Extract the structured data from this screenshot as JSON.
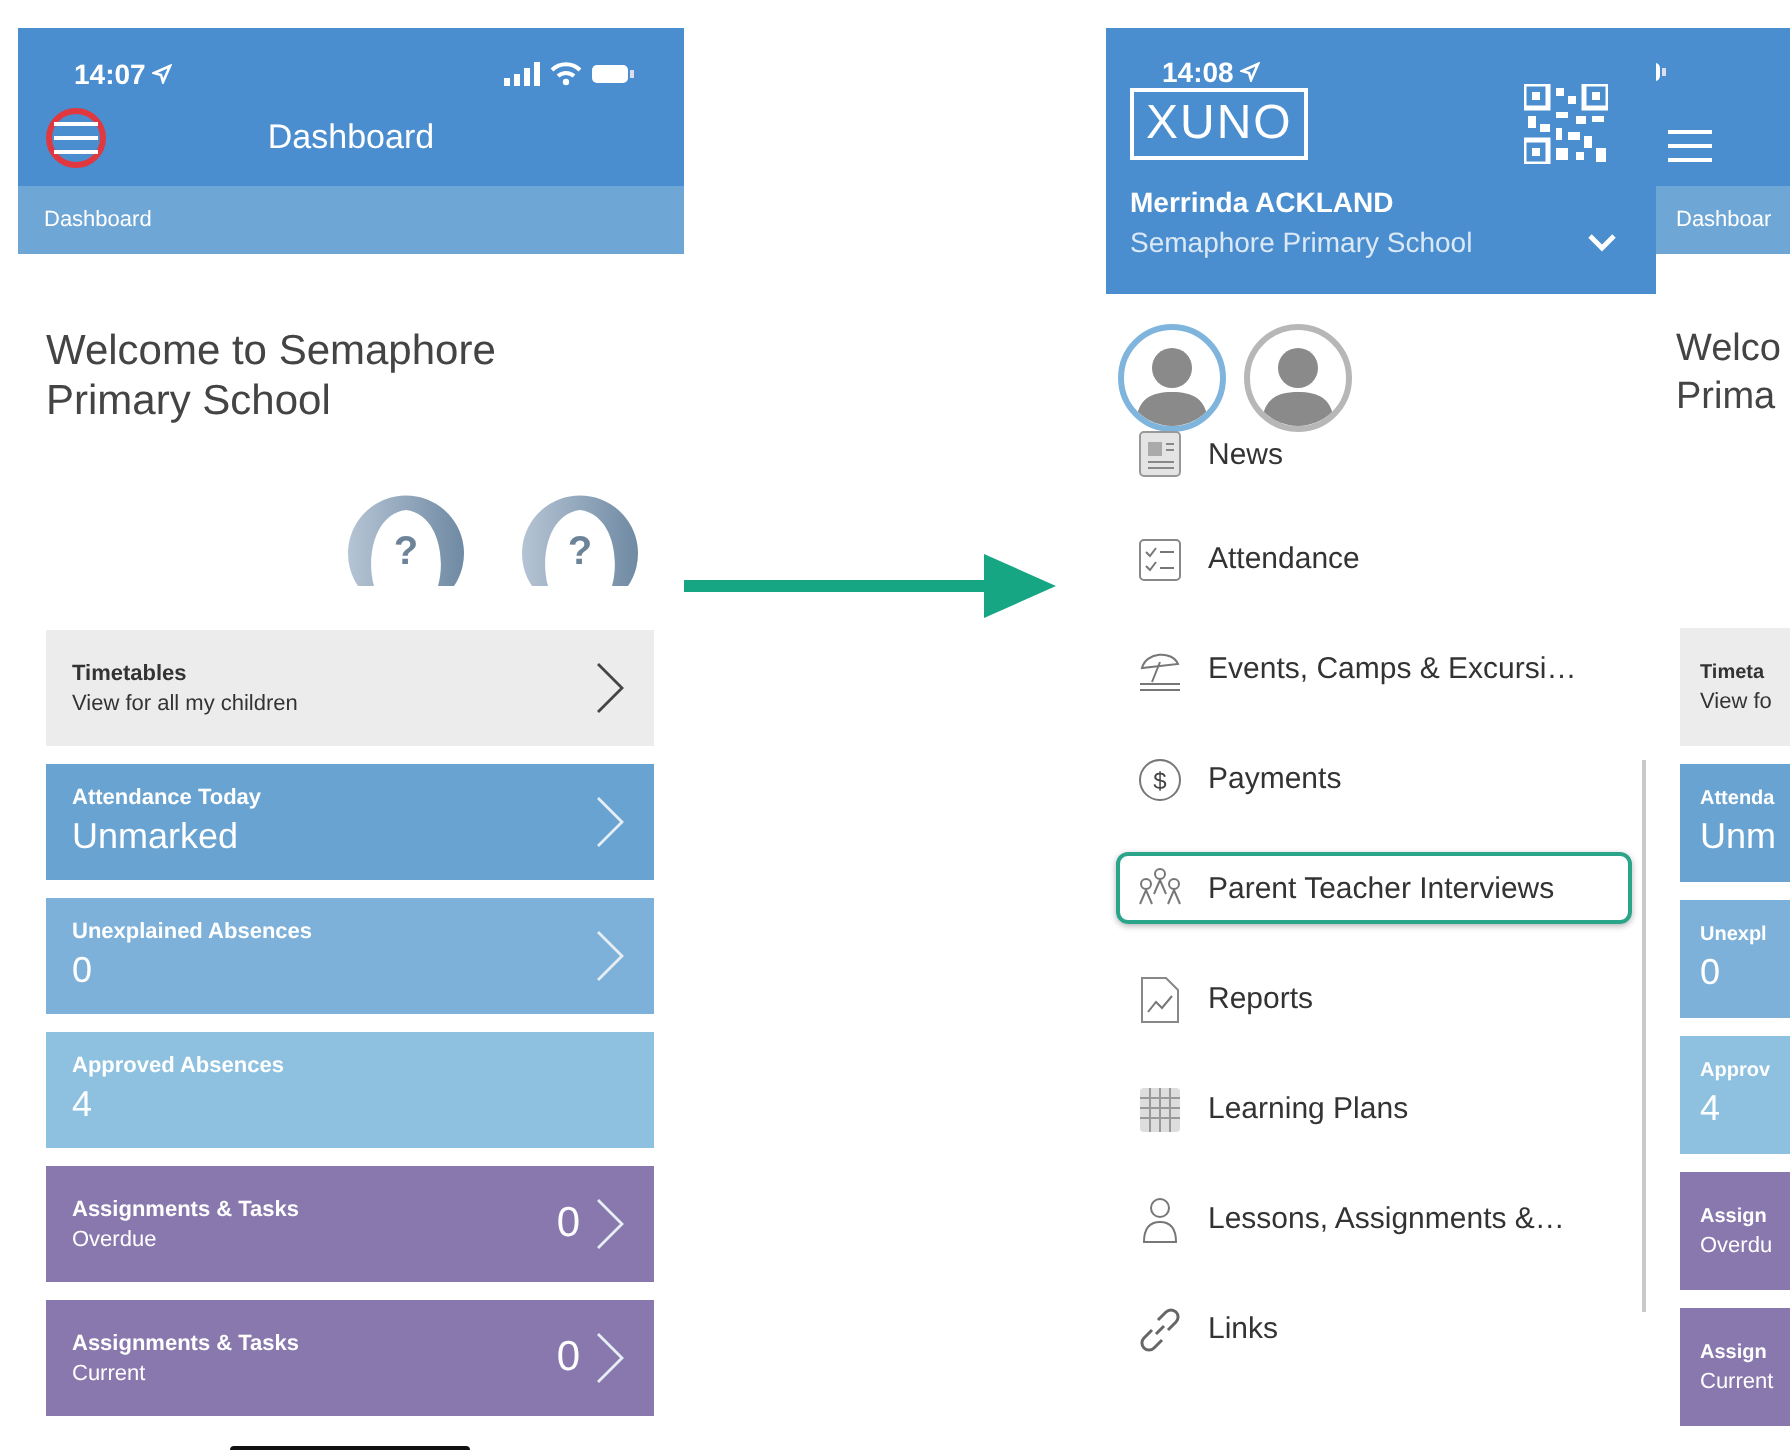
{
  "left_screen": {
    "status_time": "14:07",
    "title": "Dashboard",
    "menu_button": {
      "highlighted": true
    },
    "breadcrumb": "Dashboard",
    "welcome": "Welcome to Semaphore Primary School",
    "avatars": [
      {
        "symbol": "?"
      },
      {
        "symbol": "?"
      }
    ],
    "tiles": [
      {
        "kind": "neutral",
        "color": "#ececec",
        "title": "Timetables",
        "subtitle": "View for all my children",
        "chevron": true
      },
      {
        "kind": "stat",
        "color": "#69a3d1",
        "title": "Attendance Today",
        "value": "Unmarked",
        "chevron": true
      },
      {
        "kind": "stat",
        "color": "#7db1d9",
        "title": "Unexplained Absences",
        "value": "0",
        "chevron": true
      },
      {
        "kind": "stat",
        "color": "#8ec1e0",
        "title": "Approved Absences",
        "value": "4",
        "chevron": false
      },
      {
        "kind": "count",
        "color": "#8878ad",
        "title": "Assignments & Tasks",
        "subtitle": "Overdue",
        "count": "0",
        "chevron": true
      },
      {
        "kind": "count",
        "color": "#8878ad",
        "title": "Assignments & Tasks",
        "subtitle": "Current",
        "count": "0",
        "chevron": true
      }
    ]
  },
  "drawer": {
    "status_time": "14:08",
    "logo": "XUNO",
    "user_name": "Merrinda ACKLAND",
    "school": "Semaphore Primary School",
    "avatars": [
      {
        "selected": true
      },
      {
        "selected": false
      }
    ],
    "menu": [
      {
        "label": "News",
        "highlighted": false
      },
      {
        "label": "Attendance",
        "highlighted": false
      },
      {
        "label": "Events, Camps & Excursi…",
        "highlighted": false
      },
      {
        "label": "Payments",
        "highlighted": false,
        "icon_symbol": "$"
      },
      {
        "label": "Parent Teacher Interviews",
        "highlighted": true
      },
      {
        "label": "Reports",
        "highlighted": false
      },
      {
        "label": "Learning Plans",
        "highlighted": false
      },
      {
        "label": "Lessons, Assignments &…",
        "highlighted": false
      },
      {
        "label": "Links",
        "highlighted": false
      }
    ]
  },
  "background_screen": {
    "breadcrumb": "Dashboar",
    "welcome_lines": [
      "Welco",
      "Prima"
    ],
    "tiles": [
      {
        "color": "#ececec",
        "line_1": "Timeta",
        "line_2": "View fo"
      },
      {
        "color": "#69a3d1",
        "line_1": "Attenda",
        "line_2": "Unm"
      },
      {
        "color": "#7db1d9",
        "line_1": "Unexpl",
        "line_2": "0"
      },
      {
        "color": "#8ec1e0",
        "line_1": "Approv",
        "line_2": "4"
      },
      {
        "color": "#8878ad",
        "line_1": "Assign",
        "line_2": "Overdu"
      },
      {
        "color": "#8878ad",
        "line_1": "Assign",
        "line_2": "Current"
      }
    ]
  }
}
